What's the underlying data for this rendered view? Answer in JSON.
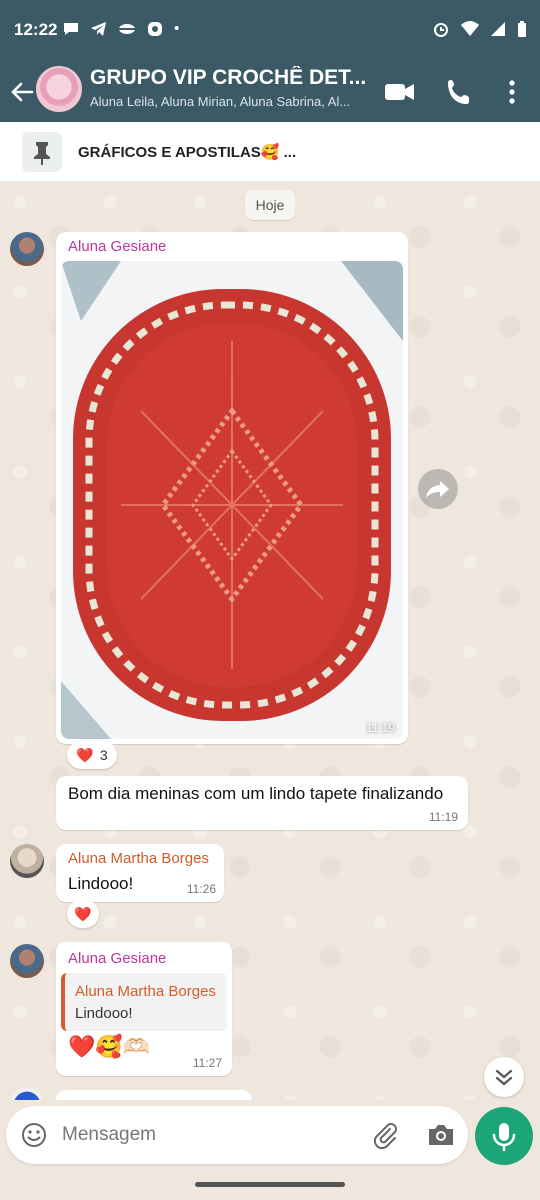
{
  "status_bar": {
    "time": "12:22",
    "dot": "•"
  },
  "header": {
    "title": "GRUPO VIP CROCHÊ DET...",
    "members": "Aluna  Leila, Aluna  Mirian, Aluna  Sabrina, Al..."
  },
  "pinned": {
    "text": "GRÁFICOS E APOSTILAS🥰 ..."
  },
  "date_chip": "Hoje",
  "messages": [
    {
      "sender": "Aluna Gesiane",
      "time": "11:19",
      "reaction_emoji": "❤️",
      "reaction_count": "3"
    },
    {
      "text": "Bom dia meninas com um lindo tapete finalizando",
      "time": "11:19"
    },
    {
      "sender": "Aluna Martha Borges",
      "text": "Lindooo!",
      "time": "11:26",
      "reaction_emoji": "❤️"
    },
    {
      "sender": "Aluna Gesiane",
      "quote_sender": "Aluna Martha Borges",
      "quote_text": "Lindooo!",
      "text": "❤️🥰🫶🏻",
      "time": "11:27"
    }
  ],
  "composer": {
    "placeholder": "Mensagem"
  },
  "colors": {
    "header": "#3b5a66",
    "mic": "#1da57a",
    "chat_bg": "#efe7dd",
    "sender_pink": "#c0369a",
    "sender_orange": "#d55b2a"
  }
}
